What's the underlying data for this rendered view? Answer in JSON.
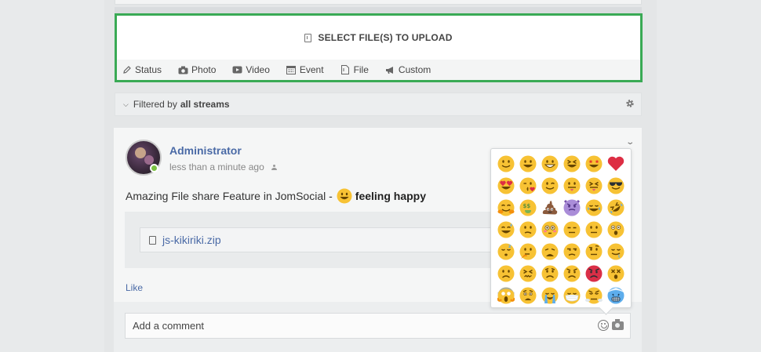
{
  "composer": {
    "upload_label": "SELECT FILE(S) TO UPLOAD",
    "tabs": [
      {
        "label": "Status",
        "icon": "pencil-icon"
      },
      {
        "label": "Photo",
        "icon": "camera-icon"
      },
      {
        "label": "Video",
        "icon": "video-icon"
      },
      {
        "label": "Event",
        "icon": "calendar-icon"
      },
      {
        "label": "File",
        "icon": "file-icon"
      },
      {
        "label": "Custom",
        "icon": "megaphone-icon"
      }
    ],
    "accent_color": "#3aaa55"
  },
  "filter": {
    "prefix": "Filtered by",
    "value": "all streams"
  },
  "post": {
    "author": "Administrator",
    "time": "less than a minute ago",
    "text": "Amazing File share Feature in JomSocial -",
    "feeling": "feeling happy",
    "attachment": "js-kikiriki.zip",
    "like_label": "Like"
  },
  "comment": {
    "placeholder": "Add a comment"
  },
  "emoji_picker": {
    "emojis": [
      "slightly-smiling",
      "grinning",
      "grin",
      "laughing",
      "star-struck",
      "red-heart",
      "heart-eyes",
      "kissing-heart",
      "winking",
      "tongue-out",
      "squint-tongue",
      "sunglasses",
      "hugging",
      "money-mouth",
      "poop",
      "imp",
      "joy",
      "rofl",
      "sweat-smile",
      "confused",
      "flushed",
      "expressionless",
      "neutral",
      "astonished",
      "sleeping",
      "thinking",
      "tired",
      "unamused",
      "raised-eyebrow",
      "drooling",
      "frowning",
      "persevering",
      "worried",
      "angry",
      "pouting",
      "dizzy",
      "scream",
      "anguished",
      "sob",
      "mask",
      "triumph",
      "cold-face"
    ]
  },
  "colors": {
    "link": "#4a6aa6",
    "online": "#7bc142",
    "emoji_yellow": "#f7c234"
  }
}
